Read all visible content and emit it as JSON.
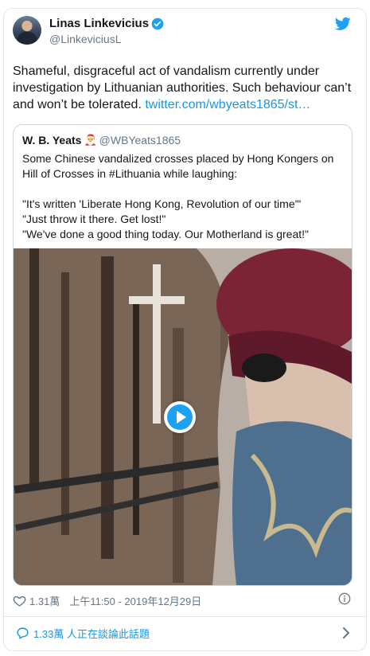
{
  "author": {
    "name": "Linas Linkevicius",
    "handle": "@LinkeviciusL"
  },
  "tweet": {
    "text": "Shameful, disgraceful act of vandalism currently under investigation by Lithuanian authorities. Such behaviour can’t and won’t be tolerated. ",
    "link": "twitter.com/wbyeats1865/st…"
  },
  "quoted": {
    "name": "W. B. Yeats",
    "emoji": "🎅",
    "handle": "@WBYeats1865",
    "text": "Some Chinese vandalized crosses placed by Hong Kongers on Hill of Crosses in #Lithuania while laughing:\n\n\"It's written 'Liberate Hong Kong, Revolution of our time'\"\n\"Just throw it there. Get lost!\"\n\"We've done a good thing today. Our Motherland is great!\""
  },
  "meta": {
    "likes": "1.31萬",
    "timestamp": "上午11:50 - 2019年12月29日"
  },
  "footer": {
    "replies": "1.33萬 人正在談論此話題"
  },
  "colors": {
    "accent": "#1da1f2",
    "link": "#1b95e0",
    "muted": "#657786",
    "border": "#e1e8ed"
  },
  "icons": [
    "verified-badge-icon",
    "twitter-bird-icon",
    "play-icon",
    "heart-icon",
    "info-icon",
    "speech-bubble-icon",
    "chevron-right-icon"
  ]
}
